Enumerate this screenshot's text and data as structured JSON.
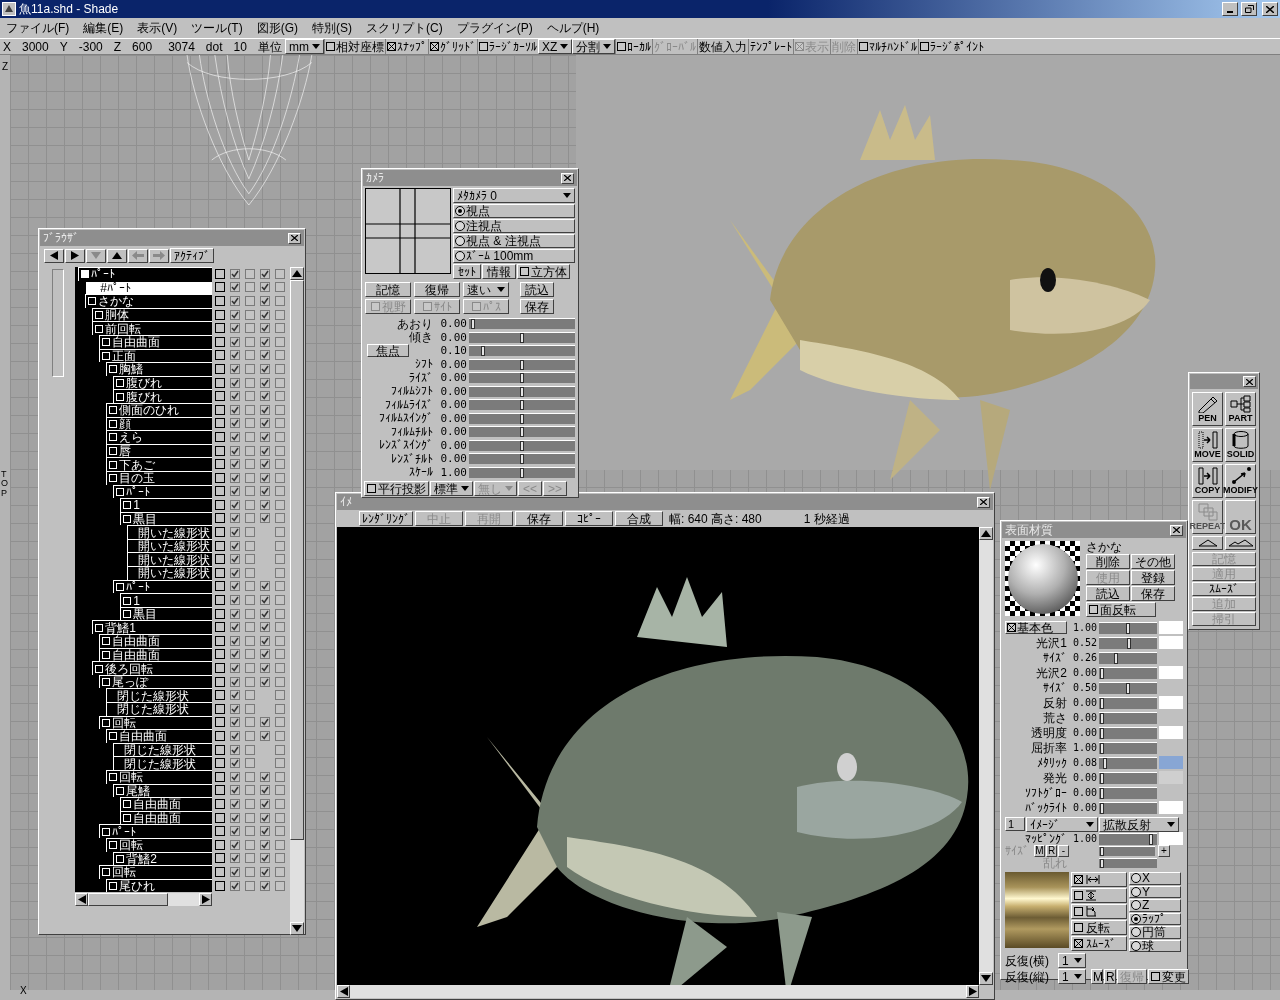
{
  "window": {
    "title": "魚11a.shd - Shade"
  },
  "menu": [
    "ファイル(F)",
    "編集(E)",
    "表示(V)",
    "ツール(T)",
    "図形(G)",
    "特別(S)",
    "スクリプト(C)",
    "プラグイン(P)",
    "ヘルプ(H)"
  ],
  "toolbar": [
    {
      "kind": "label",
      "label": "X"
    },
    {
      "kind": "value",
      "label": "3000"
    },
    {
      "kind": "label",
      "label": "Y"
    },
    {
      "kind": "value",
      "label": "-300"
    },
    {
      "kind": "label",
      "label": "Z"
    },
    {
      "kind": "value",
      "label": "600"
    },
    {
      "kind": "value",
      "label": "3074"
    },
    {
      "kind": "label",
      "label": "dot"
    },
    {
      "kind": "value",
      "label": "10"
    },
    {
      "kind": "label",
      "label": "単位"
    },
    {
      "kind": "dropdown",
      "label": "mm",
      "disabled": false
    },
    {
      "kind": "check",
      "label": "相対座標",
      "checked": false,
      "disabled": false
    },
    {
      "kind": "check",
      "label": "ｽﾅｯﾌﾟ",
      "checked": true,
      "disabled": false
    },
    {
      "kind": "check",
      "label": "ｸﾞﾘｯﾄﾞ",
      "checked": true,
      "disabled": false
    },
    {
      "kind": "check",
      "label": "ﾗｰｼﾞｶｰｿﾙ",
      "checked": false,
      "disabled": false
    },
    {
      "kind": "dropdown",
      "label": "XZ",
      "disabled": false
    },
    {
      "kind": "dropdown",
      "label": "分割",
      "disabled": false
    },
    {
      "kind": "check",
      "label": "ﾛｰｶﾙ",
      "checked": false,
      "disabled": false
    },
    {
      "kind": "button",
      "label": "ｸﾞﾛｰﾊﾞﾙ",
      "disabled": true
    },
    {
      "kind": "button",
      "label": "数値入力",
      "disabled": false
    },
    {
      "kind": "button",
      "label": "ﾃﾝﾌﾟﾚｰﾄ",
      "disabled": false
    },
    {
      "kind": "check",
      "label": "表示",
      "checked": true,
      "disabled": true
    },
    {
      "kind": "button",
      "label": "削除",
      "disabled": true
    },
    {
      "kind": "check",
      "label": "ﾏﾙﾁﾊﾝﾄﾞﾙ",
      "checked": false,
      "disabled": false
    },
    {
      "kind": "check",
      "label": "ﾗｰｼﾞﾎﾟｲﾝﾄ",
      "checked": false,
      "disabled": false
    }
  ],
  "viewport": {
    "axis_top": "Z",
    "view_label": "TOP",
    "axis_bottom": "X"
  },
  "browser": {
    "title": "ﾌﾞﾗｳｻﾞ",
    "nav": [
      {
        "kind": "left",
        "disabled": false
      },
      {
        "kind": "right",
        "disabled": false
      },
      {
        "kind": "down",
        "disabled": true
      },
      {
        "kind": "up",
        "disabled": false
      },
      {
        "kind": "arrow-left",
        "disabled": true
      },
      {
        "kind": "arrow-right",
        "disabled": true
      },
      {
        "kind": "text",
        "label": "ｱｸﾃｨﾌﾞ",
        "disabled": false
      }
    ],
    "tree": [
      {
        "label": "ﾊﾟｰﾄ",
        "kind": "root",
        "checks": [
          false,
          true,
          false,
          true,
          false
        ],
        "children": [
          {
            "label": "#ﾊﾟｰﾄ",
            "kind": "link",
            "checks": [
              false,
              true,
              false,
              true,
              false
            ]
          },
          {
            "label": "さかな",
            "kind": "part",
            "checks": [
              false,
              true,
              false,
              true,
              false
            ],
            "children": [
              {
                "label": "胴体",
                "kind": "part",
                "checks": [
                  false,
                  true,
                  false,
                  true,
                  false
                ]
              },
              {
                "label": "前回転",
                "kind": "part",
                "checks": [
                  false,
                  true,
                  false,
                  true,
                  false
                ],
                "children": [
                  {
                    "label": "自由曲面",
                    "kind": "part",
                    "checks": [
                      false,
                      true,
                      false,
                      true,
                      false
                    ]
                  },
                  {
                    "label": "正面",
                    "kind": "part",
                    "checks": [
                      false,
                      true,
                      false,
                      true,
                      false
                    ],
                    "children": [
                      {
                        "label": "胸鰭",
                        "kind": "part",
                        "checks": [
                          false,
                          true,
                          false,
                          true,
                          false
                        ],
                        "children": [
                          {
                            "label": "腹びれ",
                            "kind": "part",
                            "checks": [
                              false,
                              true,
                              false,
                              true,
                              false
                            ]
                          },
                          {
                            "label": "腹びれ",
                            "kind": "part",
                            "checks": [
                              false,
                              true,
                              false,
                              true,
                              false
                            ]
                          }
                        ]
                      },
                      {
                        "label": "側面のひれ",
                        "kind": "part",
                        "checks": [
                          false,
                          true,
                          false,
                          true,
                          false
                        ]
                      },
                      {
                        "label": "顔",
                        "kind": "part",
                        "checks": [
                          false,
                          true,
                          false,
                          true,
                          false
                        ]
                      },
                      {
                        "label": "えら",
                        "kind": "part",
                        "checks": [
                          false,
                          true,
                          false,
                          true,
                          false
                        ]
                      },
                      {
                        "label": "唇",
                        "kind": "part",
                        "checks": [
                          false,
                          true,
                          false,
                          true,
                          false
                        ]
                      },
                      {
                        "label": "下あご",
                        "kind": "part",
                        "checks": [
                          false,
                          true,
                          false,
                          true,
                          false
                        ]
                      },
                      {
                        "label": "目の玉",
                        "kind": "part",
                        "checks": [
                          false,
                          true,
                          false,
                          true,
                          false
                        ],
                        "children": [
                          {
                            "label": "ﾊﾟｰﾄ",
                            "kind": "part",
                            "checks": [
                              false,
                              true,
                              false,
                              true,
                              false
                            ],
                            "children": [
                              {
                                "label": "1",
                                "kind": "part",
                                "checks": [
                                  false,
                                  true,
                                  false,
                                  true,
                                  false
                                ]
                              },
                              {
                                "label": "黒目",
                                "kind": "part",
                                "checks": [
                                  false,
                                  true,
                                  false,
                                  true,
                                  false
                                ],
                                "children": [
                                  {
                                    "label": "開いた線形状",
                                    "kind": "shape",
                                    "checks": [
                                      false,
                                      true,
                                      false,
                                      false
                                    ]
                                  },
                                  {
                                    "label": "開いた線形状",
                                    "kind": "shape",
                                    "checks": [
                                      false,
                                      true,
                                      false,
                                      false
                                    ]
                                  },
                                  {
                                    "label": "開いた線形状",
                                    "kind": "shape",
                                    "checks": [
                                      false,
                                      true,
                                      false,
                                      false
                                    ]
                                  },
                                  {
                                    "label": "開いた線形状",
                                    "kind": "shape",
                                    "checks": [
                                      false,
                                      true,
                                      false,
                                      false
                                    ]
                                  }
                                ]
                              }
                            ]
                          },
                          {
                            "label": "ﾊﾟｰﾄ",
                            "kind": "part",
                            "checks": [
                              false,
                              true,
                              false,
                              true,
                              false
                            ],
                            "children": [
                              {
                                "label": "1",
                                "kind": "part",
                                "checks": [
                                  false,
                                  true,
                                  false,
                                  true,
                                  false
                                ]
                              },
                              {
                                "label": "黒目",
                                "kind": "part",
                                "checks": [
                                  false,
                                  true,
                                  false,
                                  true,
                                  false
                                ]
                              }
                            ]
                          }
                        ]
                      }
                    ]
                  }
                ]
              },
              {
                "label": "背鰭1",
                "kind": "part",
                "checks": [
                  false,
                  true,
                  false,
                  true,
                  false
                ],
                "children": [
                  {
                    "label": "自由曲面",
                    "kind": "part",
                    "checks": [
                      false,
                      true,
                      false,
                      true,
                      false
                    ]
                  },
                  {
                    "label": "自由曲面",
                    "kind": "part",
                    "checks": [
                      false,
                      true,
                      false,
                      true,
                      false
                    ]
                  }
                ]
              },
              {
                "label": "後ろ回転",
                "kind": "part",
                "checks": [
                  false,
                  true,
                  false,
                  true,
                  false
                ],
                "children": [
                  {
                    "label": "尾っぽ",
                    "kind": "part",
                    "checks": [
                      false,
                      true,
                      false,
                      true,
                      false
                    ],
                    "children": [
                      {
                        "label": "閉じた線形状",
                        "kind": "shape",
                        "checks": [
                          false,
                          true,
                          false,
                          false
                        ]
                      },
                      {
                        "label": "閉じた線形状",
                        "kind": "shape",
                        "checks": [
                          false,
                          true,
                          false,
                          false
                        ]
                      }
                    ]
                  },
                  {
                    "label": "回転",
                    "kind": "part",
                    "checks": [
                      false,
                      true,
                      false,
                      true,
                      false
                    ],
                    "children": [
                      {
                        "label": "自由曲面",
                        "kind": "part",
                        "checks": [
                          false,
                          true,
                          false,
                          true,
                          false
                        ],
                        "children": [
                          {
                            "label": "閉じた線形状",
                            "kind": "shape",
                            "checks": [
                              false,
                              true,
                              false,
                              false
                            ]
                          },
                          {
                            "label": "閉じた線形状",
                            "kind": "shape",
                            "checks": [
                              false,
                              true,
                              false,
                              false
                            ]
                          }
                        ]
                      },
                      {
                        "label": "回転",
                        "kind": "part",
                        "checks": [
                          false,
                          true,
                          false,
                          true,
                          false
                        ],
                        "children": [
                          {
                            "label": "尾鰭",
                            "kind": "part",
                            "checks": [
                              false,
                              true,
                              false,
                              true,
                              false
                            ],
                            "children": [
                              {
                                "label": "自由曲面",
                                "kind": "part",
                                "checks": [
                                  false,
                                  true,
                                  false,
                                  true,
                                  false
                                ]
                              },
                              {
                                "label": "自由曲面",
                                "kind": "part",
                                "checks": [
                                  false,
                                  true,
                                  false,
                                  true,
                                  false
                                ]
                              }
                            ]
                          }
                        ]
                      }
                    ]
                  },
                  {
                    "label": "ﾊﾟｰﾄ",
                    "kind": "part",
                    "checks": [
                      false,
                      true,
                      false,
                      true,
                      false
                    ],
                    "children": [
                      {
                        "label": "回転",
                        "kind": "part",
                        "checks": [
                          false,
                          true,
                          false,
                          true,
                          false
                        ],
                        "children": [
                          {
                            "label": "背鰭2",
                            "kind": "part",
                            "checks": [
                              false,
                              true,
                              false,
                              true,
                              false
                            ]
                          }
                        ]
                      }
                    ]
                  },
                  {
                    "label": "回転",
                    "kind": "part",
                    "checks": [
                      false,
                      true,
                      false,
                      true,
                      false
                    ],
                    "children": [
                      {
                        "label": "尾ひれ",
                        "kind": "part",
                        "checks": [
                          false,
                          true,
                          false,
                          true,
                          false
                        ]
                      }
                    ]
                  }
                ]
              }
            ]
          }
        ]
      }
    ]
  },
  "camera": {
    "title": "ｶﾒﾗ",
    "camera_select": "ﾒﾀｶﾒﾗ 0",
    "modes": [
      {
        "label": "視点",
        "selected": true
      },
      {
        "label": "注視点",
        "selected": false
      },
      {
        "label": "視点 & 注視点",
        "selected": false
      },
      {
        "label": "ｽﾞｰﾑ 100mm",
        "selected": false
      }
    ],
    "mode_buttons": [
      {
        "kind": "button",
        "label": "ｾｯﾄ"
      },
      {
        "kind": "button",
        "label": "情報"
      },
      {
        "kind": "check",
        "label": "立方体",
        "checked": false
      }
    ],
    "controls": [
      [
        {
          "kind": "button",
          "label": "記憶",
          "disabled": false
        },
        {
          "kind": "button",
          "label": "復帰",
          "disabled": false
        },
        {
          "kind": "dropdown",
          "label": "速い",
          "disabled": false
        },
        {
          "kind": "button",
          "label": "読込",
          "disabled": false
        }
      ],
      [
        {
          "kind": "check",
          "label": "視野",
          "checked": false,
          "disabled": true
        },
        {
          "kind": "check",
          "label": "ｻｲﾄ",
          "checked": false,
          "disabled": true
        },
        {
          "kind": "check",
          "label": "ﾊﾟｽ",
          "checked": false,
          "disabled": true
        },
        {
          "kind": "button",
          "label": "保存",
          "disabled": false
        }
      ]
    ],
    "sliders": [
      {
        "kind": "label",
        "label": "あおり",
        "value": "0.00",
        "level": 0.02
      },
      {
        "kind": "label",
        "label": "傾き",
        "value": "0.00",
        "level": 0.5
      },
      {
        "kind": "button",
        "label": "焦点",
        "value": "0.10",
        "level": 0.12
      },
      {
        "kind": "label",
        "label": "ｼﾌﾄ",
        "value": "0.00",
        "level": 0.5
      },
      {
        "kind": "label",
        "label": "ﾗｲｽﾞ",
        "value": "0.00",
        "level": 0.5
      },
      {
        "kind": "label",
        "label": "ﾌｨﾙﾑｼﾌﾄ",
        "value": "0.00",
        "level": 0.5
      },
      {
        "kind": "label",
        "label": "ﾌｨﾙﾑﾗｲｽﾞ",
        "value": "0.00",
        "level": 0.5
      },
      {
        "kind": "label",
        "label": "ﾌｨﾙﾑｽｲﾝｸﾞ",
        "value": "0.00",
        "level": 0.5
      },
      {
        "kind": "label",
        "label": "ﾌｨﾙﾑﾁﾙﾄ",
        "value": "0.00",
        "level": 0.5
      },
      {
        "kind": "label",
        "label": "ﾚﾝｽﾞｽｲﾝｸﾞ",
        "value": "0.00",
        "level": 0.5
      },
      {
        "kind": "label",
        "label": "ﾚﾝｽﾞﾁﾙﾄ",
        "value": "0.00",
        "level": 0.5
      },
      {
        "kind": "label",
        "label": "ｽｹｰﾙ",
        "value": "1.00",
        "level": 0.5
      }
    ],
    "footer": [
      {
        "kind": "check",
        "label": "平行投影",
        "checked": false,
        "disabled": false
      },
      {
        "kind": "dropdown",
        "label": "標準",
        "disabled": false
      },
      {
        "kind": "dropdown",
        "label": "無し",
        "disabled": true
      },
      {
        "kind": "button",
        "label": "<<",
        "disabled": true
      },
      {
        "kind": "button",
        "label": ">>",
        "disabled": true
      }
    ]
  },
  "render": {
    "title": "ｲﾒ",
    "toolbar": [
      {
        "label": "ﾚﾝﾀﾞﾘﾝｸﾞ",
        "disabled": false
      },
      {
        "label": "中止",
        "disabled": true
      },
      {
        "label": "再開",
        "disabled": true
      },
      {
        "label": "保存",
        "disabled": false
      },
      {
        "label": "ｺﾋﾟｰ",
        "disabled": false
      },
      {
        "label": "合成",
        "disabled": false
      }
    ],
    "size": "幅: 640 高さ: 480",
    "elapsed": "1 秒経過"
  },
  "material": {
    "title": "表面材質",
    "name": "さかな",
    "buttons": [
      {
        "label": "削除",
        "disabled": false
      },
      {
        "label": "その他",
        "disabled": false
      },
      {
        "label": "使用",
        "disabled": true
      },
      {
        "label": "登録",
        "disabled": false
      },
      {
        "label": "読込",
        "disabled": false
      },
      {
        "label": "保存",
        "disabled": false
      }
    ],
    "flip": {
      "label": "面反転",
      "checked": false
    },
    "sliders": [
      {
        "kind": "check",
        "label": "基本色",
        "checked": true,
        "value": "1.00",
        "level": 0.5,
        "color": "#ffffff"
      },
      {
        "kind": "label",
        "label": "光沢1",
        "value": "0.52",
        "level": 0.52,
        "color": "#ffffff"
      },
      {
        "kind": "label",
        "label": "ｻｲｽﾞ",
        "value": "0.26",
        "level": 0.28
      },
      {
        "kind": "label",
        "label": "光沢2",
        "value": "0.00",
        "level": 0.02,
        "color": "#ffffff"
      },
      {
        "kind": "label",
        "label": "ｻｲｽﾞ",
        "value": "0.50",
        "level": 0.5
      },
      {
        "kind": "label",
        "label": "反射",
        "value": "0.00",
        "level": 0.02,
        "color": "#ffffff"
      },
      {
        "kind": "label",
        "label": "荒さ",
        "value": "0.00",
        "level": 0.02
      },
      {
        "kind": "label",
        "label": "透明度",
        "value": "0.00",
        "level": 0.02,
        "color": "#ffffff"
      },
      {
        "kind": "label",
        "label": "屈折率",
        "value": "1.00",
        "level": 0.02
      },
      {
        "kind": "label",
        "label": "ﾒﾀﾘｯｸ",
        "value": "0.08",
        "level": 0.08,
        "color": "#88a6d4"
      },
      {
        "kind": "label",
        "label": "発光",
        "value": "0.00",
        "level": 0.02,
        "color": "#cfcfcf"
      },
      {
        "kind": "label",
        "label": "ｿﾌﾄｸﾞﾛｰ",
        "value": "0.00",
        "level": 0.02
      },
      {
        "kind": "label",
        "label": "ﾊﾞｯｸﾗｲﾄ",
        "value": "0.00",
        "level": 0.02,
        "color": "#ffffff"
      }
    ],
    "layer": {
      "index": "1",
      "type": "ｲﾒｰｼﾞ",
      "channel": "拡散反射"
    },
    "mapping": {
      "label": "ﾏｯﾋﾟﾝｸﾞ",
      "value": "1.00",
      "level": 0.93,
      "color": "#ffffff"
    },
    "size_row": {
      "label": "ｻｲｽﾞ",
      "buttons": [
        "M",
        "R",
        "-"
      ],
      "plus": "+",
      "level": 0.02
    },
    "noise": {
      "label": "乱れ",
      "level": 0.02
    },
    "options": [
      {
        "kind": "stretch-h",
        "checked": true
      },
      {
        "kind": "stretch-v",
        "checked": false
      },
      {
        "kind": "rotate",
        "checked": false
      },
      {
        "kind": "text",
        "label": "反転",
        "checked": false
      },
      {
        "kind": "text",
        "label": "ｽﾑｰｽﾞ",
        "checked": true
      }
    ],
    "projections": [
      {
        "label": "X",
        "selected": false
      },
      {
        "label": "Y",
        "selected": false
      },
      {
        "label": "Z",
        "selected": false
      },
      {
        "label": "ﾗｯﾌﾟ",
        "selected": true
      },
      {
        "label": "円筒",
        "selected": false
      },
      {
        "label": "球",
        "selected": false
      }
    ],
    "repeat": [
      {
        "label": "反復(横)",
        "value": "1"
      },
      {
        "label": "反復(縦)",
        "value": "1"
      }
    ],
    "footer": [
      {
        "kind": "button",
        "label": "M",
        "disabled": false
      },
      {
        "kind": "button",
        "label": "R",
        "disabled": false
      },
      {
        "kind": "button",
        "label": "復帰",
        "disabled": true
      },
      {
        "kind": "check",
        "label": "変更",
        "checked": false,
        "disabled": false
      }
    ]
  },
  "palette": {
    "tools": [
      {
        "kind": "pen",
        "label": "PEN",
        "disabled": false
      },
      {
        "kind": "part",
        "label": "PART",
        "disabled": false
      },
      {
        "kind": "move",
        "label": "MOVE",
        "disabled": false
      },
      {
        "kind": "solid",
        "label": "SOLID",
        "disabled": false
      },
      {
        "kind": "copy",
        "label": "COPY",
        "disabled": false
      },
      {
        "kind": "modify",
        "label": "MODIFY",
        "disabled": false
      },
      {
        "kind": "repeat",
        "label": "REPEAT",
        "disabled": true
      },
      {
        "kind": "ok",
        "label": "OK",
        "disabled": true
      }
    ],
    "shape_buttons": [
      {
        "kind": "triangle"
      },
      {
        "kind": "peaks"
      }
    ],
    "actions": [
      {
        "label": "記憶",
        "disabled": true
      },
      {
        "label": "適用",
        "disabled": true
      },
      {
        "label": "ｽﾑｰｽﾞ",
        "disabled": false
      },
      {
        "label": "追加",
        "disabled": true
      },
      {
        "label": "掃引",
        "disabled": true
      }
    ]
  }
}
